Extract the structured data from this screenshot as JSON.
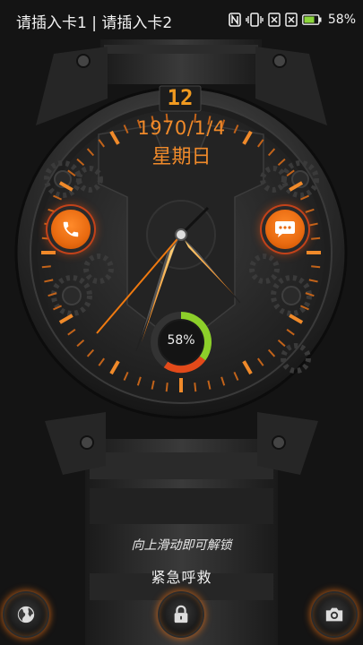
{
  "status_bar": {
    "carrier_text": "请插入卡1 | 请插入卡2",
    "battery_percent": "58%",
    "icons": [
      "nfc-icon",
      "vibrate-icon",
      "no-sim-1-icon",
      "no-sim-2-icon",
      "battery-icon"
    ]
  },
  "watch_face": {
    "hour_marker": "12",
    "date": "1970/1/4",
    "weekday": "星期日",
    "battery_gauge_label": "58%",
    "battery_gauge_level": 0.58,
    "left_app_icon": "phone-icon",
    "right_app_icon": "message-icon",
    "accent_color": "#f08a2a"
  },
  "lockscreen": {
    "unlock_hint": "向上滑动即可解锁",
    "emergency_label": "紧急呼救",
    "shortcuts": [
      "globe-icon",
      "lock-icon",
      "camera-icon"
    ]
  }
}
